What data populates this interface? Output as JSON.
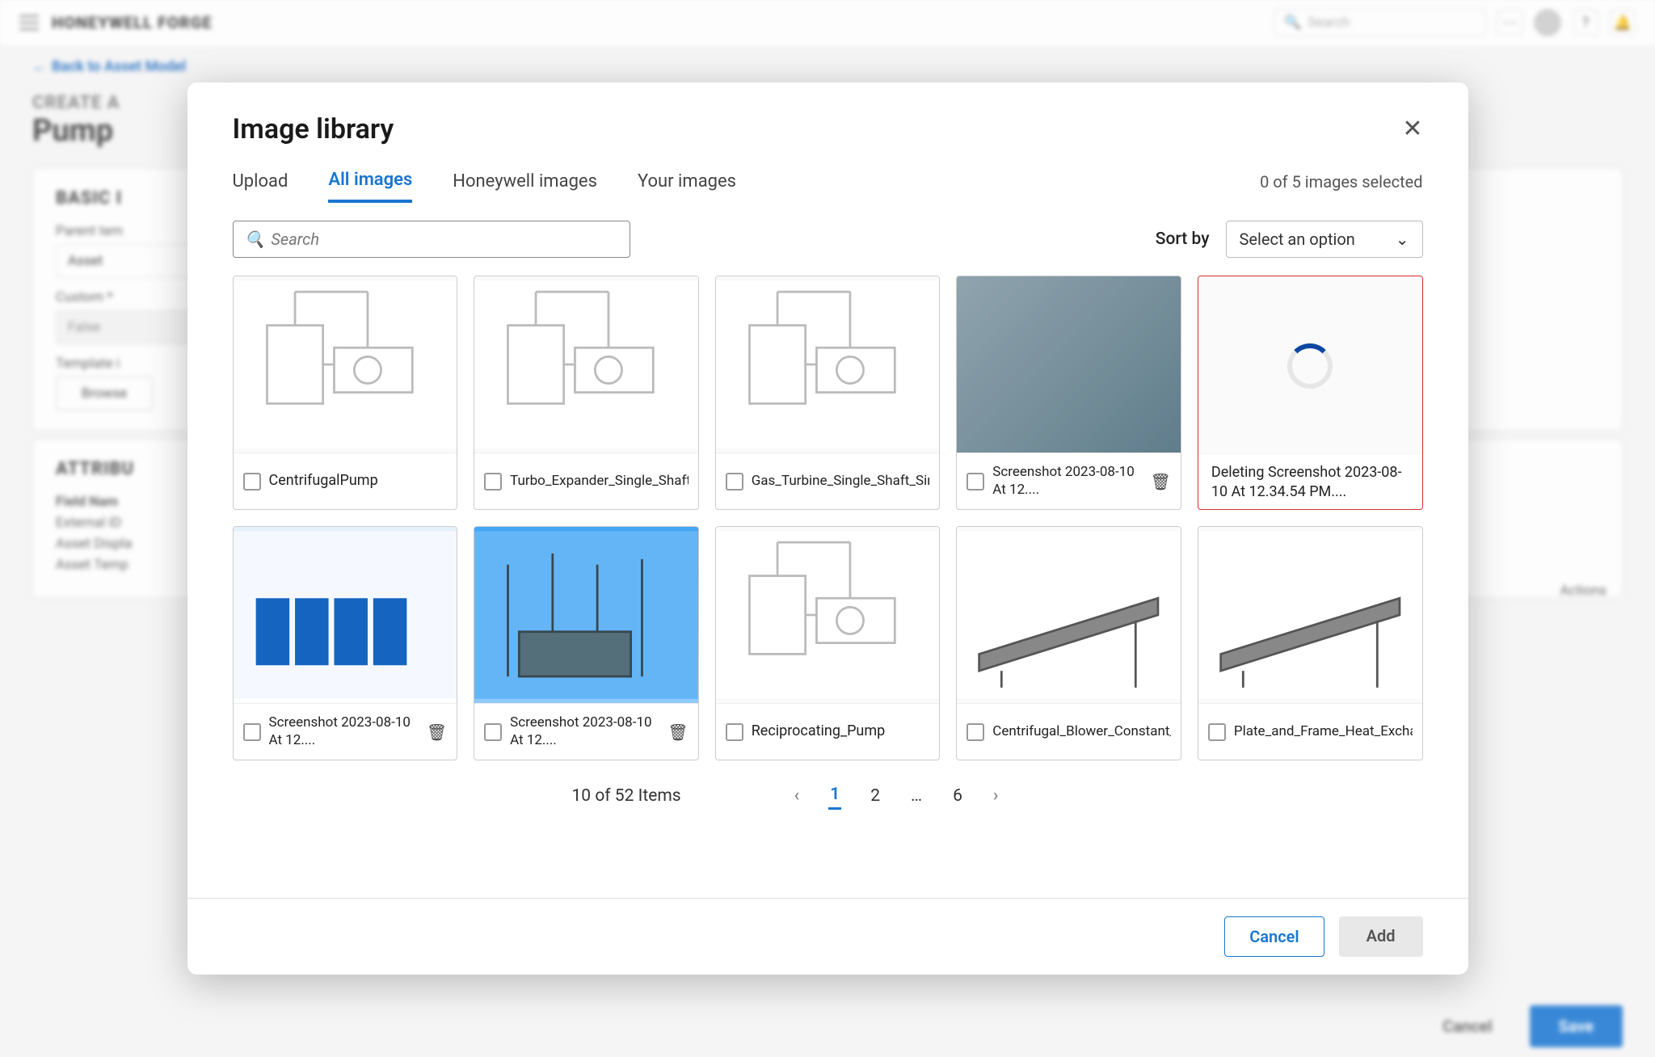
{
  "brand": "HONEYWELL FORGE",
  "back_link": "Back to Asset Model",
  "create_label": "CREATE A",
  "page_title": "Pump",
  "bg": {
    "basic_info": "BASIC I",
    "parent_label": "Parent tem",
    "asset_value": "Asset",
    "custom_label": "Custom  *",
    "false_value": "False",
    "template_label": "Template i",
    "browse": "Browse",
    "attributes": "ATTRIBU",
    "col1": "Field Nam",
    "row1": "External ID",
    "row2": "Asset Displa",
    "row3": "Asset Temp",
    "actions": "Actions",
    "cancel": "Cancel",
    "save": "Save"
  },
  "top": {
    "search_placeholder": "Search"
  },
  "modal": {
    "title": "Image library",
    "tabs": [
      "Upload",
      "All images",
      "Honeywell images",
      "Your images"
    ],
    "active_tab": 1,
    "selection_text": "0 of 5 images selected",
    "search_placeholder": "Search",
    "sort_label": "Sort by",
    "sort_placeholder": "Select an option",
    "cards": [
      {
        "label": "CentrifugalPump",
        "has_trash": false,
        "thumb": "diagram"
      },
      {
        "label": "Turbo_Expander_Single_Shaft_Single_Unit_Consta...",
        "has_trash": false,
        "thumb": "diagram"
      },
      {
        "label": "Gas_Turbine_Single_Shaft_Simple_Cycle",
        "has_trash": false,
        "thumb": "diagram"
      },
      {
        "label": "Screenshot 2023-08-10 At 12....",
        "has_trash": true,
        "thumb": "photo"
      },
      {
        "label": "Deleting Screenshot 2023-08-10 At 12.34.54 PM....",
        "deleting": true
      },
      {
        "label": "Screenshot 2023-08-10 At 12....",
        "has_trash": true,
        "thumb": "bluebox"
      },
      {
        "label": "Screenshot 2023-08-10 At 12....",
        "has_trash": true,
        "thumb": "substation"
      },
      {
        "label": "Reciprocating_Pump",
        "has_trash": false,
        "thumb": "diagram"
      },
      {
        "label": "Centrifugal_Blower_Constant_Speed",
        "has_trash": false,
        "thumb": "conveyor"
      },
      {
        "label": "Plate_and_Frame_Heat_Exchanger",
        "has_trash": false,
        "thumb": "conveyor"
      }
    ],
    "pager": {
      "count": "10 of 52 Items",
      "pages": [
        "1",
        "2",
        "…",
        "6"
      ],
      "active": 0
    },
    "cancel": "Cancel",
    "add": "Add"
  }
}
